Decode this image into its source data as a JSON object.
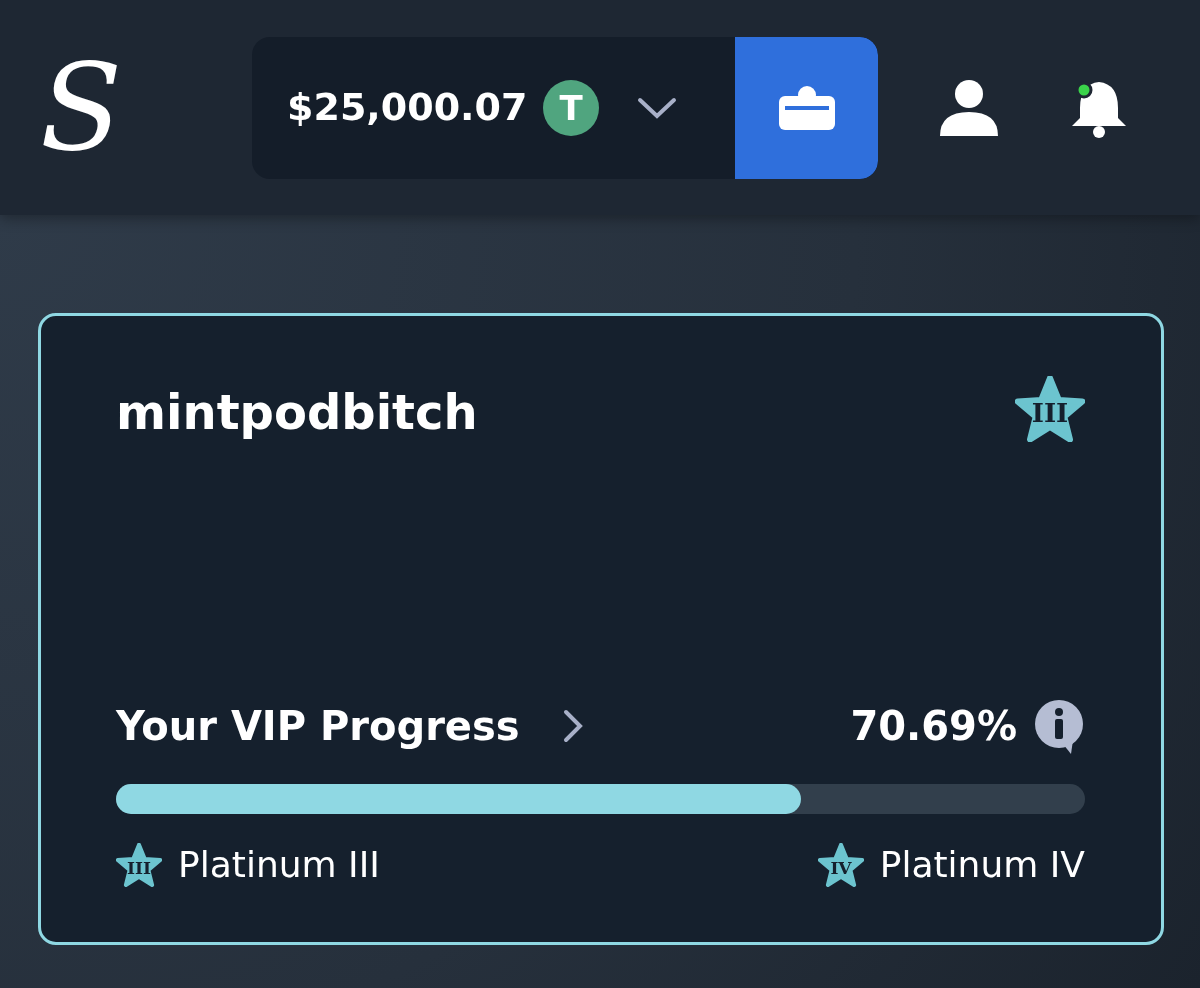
{
  "header": {
    "logo": "S",
    "balance": "$25,000.07",
    "currency_symbol": "T",
    "notification_unread": true
  },
  "card": {
    "username": "mintpodbitch",
    "tier_numeral": "III",
    "progress": {
      "label": "Your VIP Progress",
      "percent": "70.69%",
      "level": 0.7069,
      "current_tier": {
        "name": "Platinum III",
        "numeral": "III"
      },
      "next_tier": {
        "name": "Platinum IV",
        "numeral": "IV"
      }
    }
  }
}
